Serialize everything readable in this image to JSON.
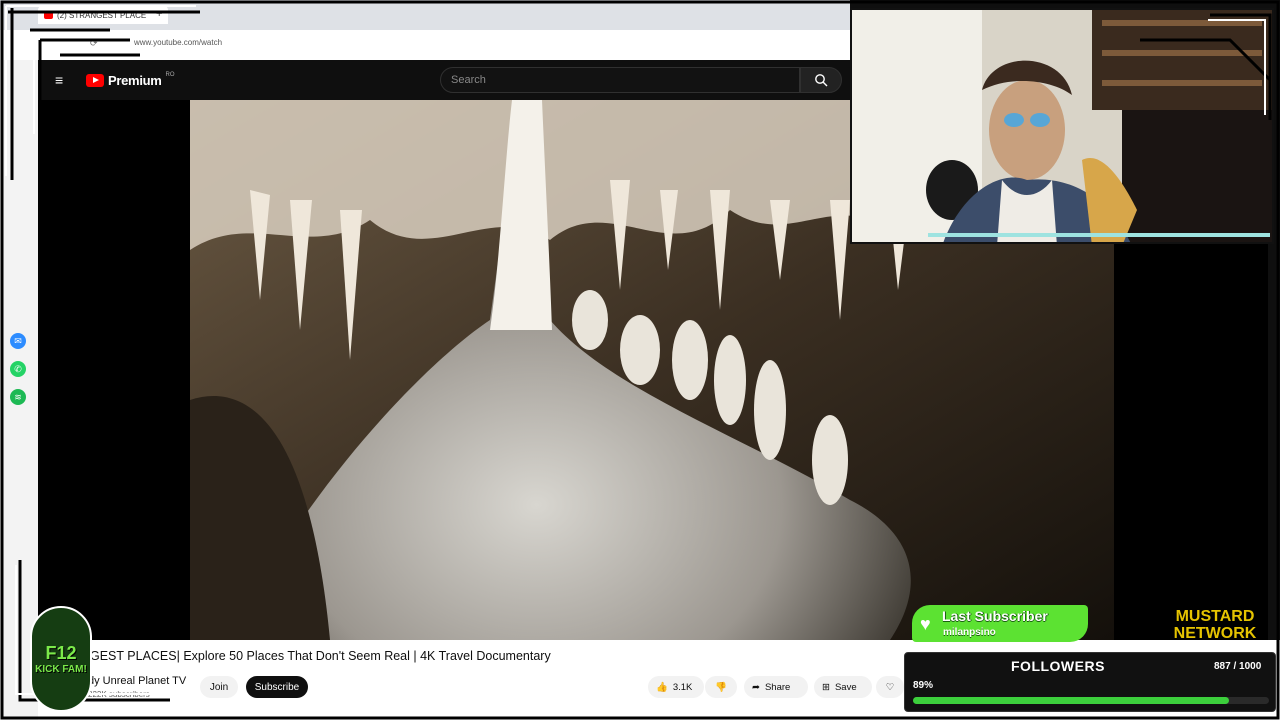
{
  "browser": {
    "tab_title": "(2) STRANGEST PLACE",
    "new_tab": "+",
    "url": "www.youtube.com/watch"
  },
  "youtube": {
    "logo_text": "Premium",
    "logo_region": "RO",
    "search_placeholder": "Search"
  },
  "video": {
    "title": "GEST PLACES| Explore 50 Places That Don't Seem Real | 4K Travel Documentary",
    "channel": "dy Unreal Planet TV",
    "subscribers": "222K subscribers",
    "join_label": "Join",
    "subscribe_label": "Subscribe",
    "likes": "3.1K",
    "share_label": "Share",
    "save_label": "Save"
  },
  "overlay": {
    "last_subscriber_title": "Last Subscriber",
    "last_subscriber_name": "milanpsino",
    "followers_title": "FOLLOWERS",
    "followers_count": "887 / 1000",
    "followers_percent": "89%",
    "followers_fraction": 0.887,
    "network_line1": "MUSTARD",
    "network_line2": "NETWORK",
    "emblem_line1": "F12",
    "emblem_line2": "KICK FAM!"
  },
  "colors": {
    "youtube_red": "#ff0000",
    "followers_bar": "#3ccf3c",
    "subscriber_badge": "#5ce232"
  }
}
